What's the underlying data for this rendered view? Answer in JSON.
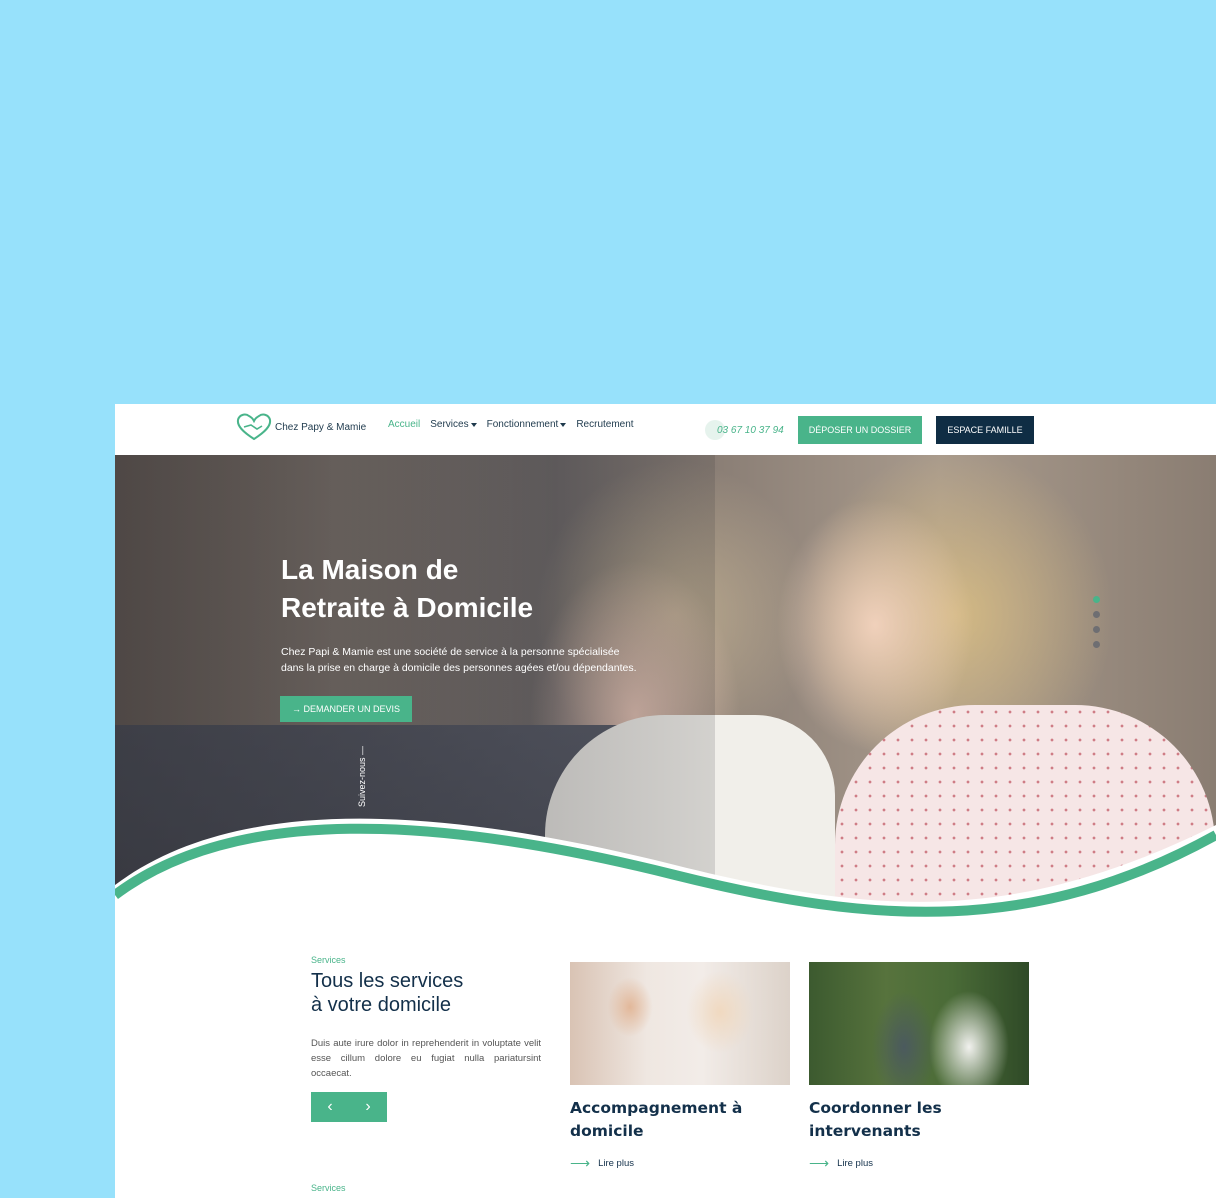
{
  "header": {
    "brand": "Chez Papy & Mamie",
    "nav": [
      {
        "label": "Accueil",
        "active": true,
        "dropdown": false
      },
      {
        "label": "Services",
        "active": false,
        "dropdown": true
      },
      {
        "label": "Fonctionnement",
        "active": false,
        "dropdown": true
      },
      {
        "label": "Recrutement",
        "active": false,
        "dropdown": false
      }
    ],
    "phone": "03 67 10 37 94",
    "cta_primary": "DÉPOSER UN DOSSIER",
    "cta_secondary": "ESPACE FAMILLE"
  },
  "hero": {
    "title_line1": "La Maison de",
    "title_line2": "Retraite à Domicile",
    "subtitle_line1": "Chez Papi & Mamie est une société de service à la personne spécialisée",
    "subtitle_line2": "dans la prise en charge à domicile des personnes agées et/ou dépendantes.",
    "button": "→ DEMANDER UN DEVIS",
    "follow": "Suivez-nous —",
    "slides": 4,
    "active_slide": 1
  },
  "services": {
    "eyebrow": "Services",
    "title_line1": "Tous les services",
    "title_line2": "à votre domicile",
    "description": "Duis aute irure dolor in reprehenderit in voluptate velit esse cillum dolore eu fugiat nulla pariatursint occaecat.",
    "prev": "‹",
    "next": "›",
    "cards": [
      {
        "title_line1": "Accompagnement à",
        "title_line2": "domicile",
        "link": "Lire plus"
      },
      {
        "title_line1": "Coordonner les",
        "title_line2": "intervenants",
        "link": "Lire plus"
      }
    ],
    "next_eyebrow": "Services"
  },
  "colors": {
    "accent": "#49b48a",
    "navy": "#0f2d44",
    "background": "#97e1fb"
  }
}
